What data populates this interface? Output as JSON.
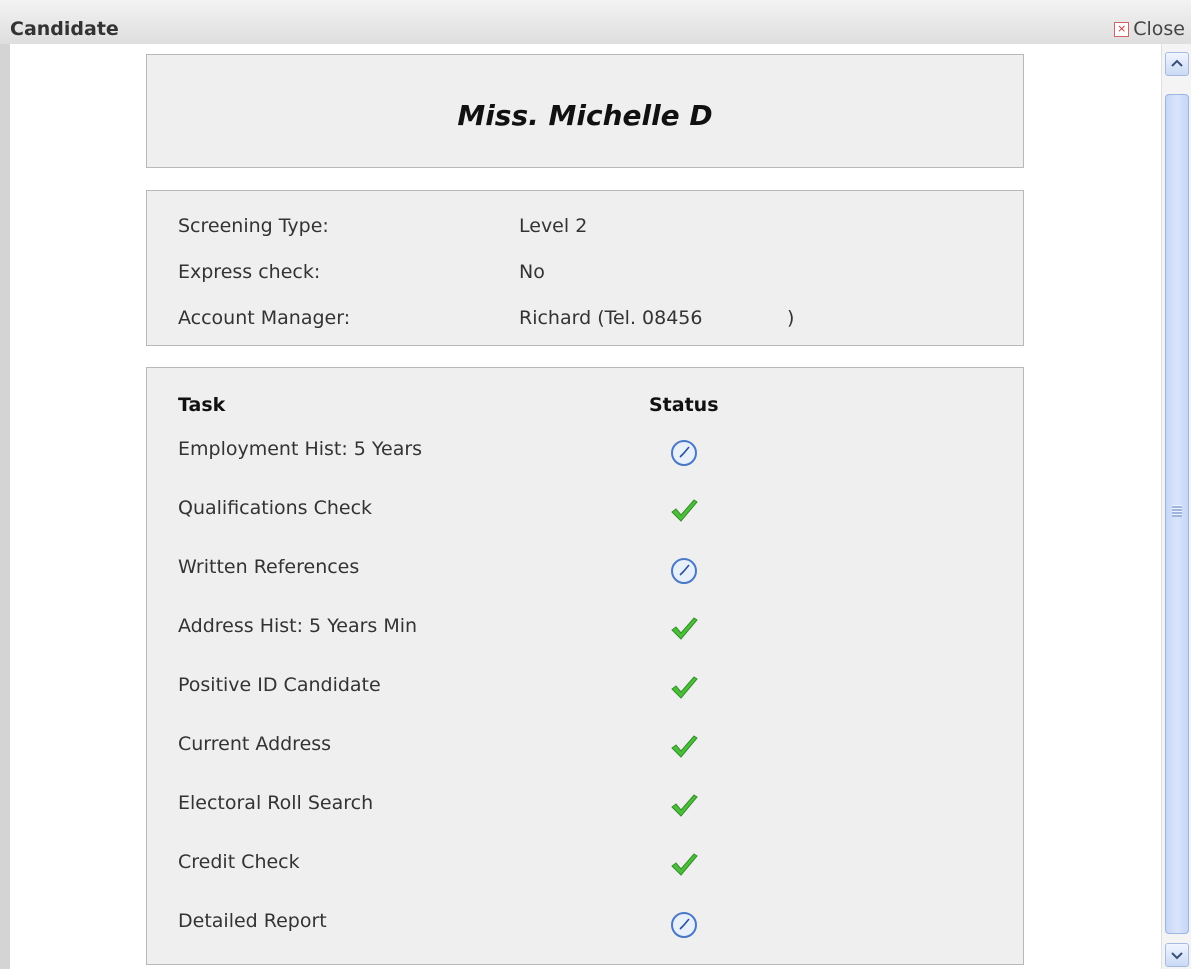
{
  "window": {
    "title": "Candidate",
    "close_label": "Close"
  },
  "candidate": {
    "name": "Miss. Michelle D"
  },
  "info": [
    {
      "label": "Screening Type:",
      "value": "Level 2"
    },
    {
      "label": "Express check:",
      "value": "No"
    },
    {
      "label": "Account Manager:",
      "value": "Richard (Tel. 08456              )"
    }
  ],
  "tasks": {
    "header_task": "Task",
    "header_status": "Status",
    "rows": [
      {
        "name": "Employment Hist: 5 Years",
        "status": "pending"
      },
      {
        "name": "Qualifications Check",
        "status": "complete"
      },
      {
        "name": "Written References",
        "status": "pending"
      },
      {
        "name": "Address Hist: 5 Years Min",
        "status": "complete"
      },
      {
        "name": "Positive ID Candidate",
        "status": "complete"
      },
      {
        "name": "Current Address",
        "status": "complete"
      },
      {
        "name": "Electoral Roll Search",
        "status": "complete"
      },
      {
        "name": "Credit Check",
        "status": "complete"
      },
      {
        "name": "Detailed Report",
        "status": "pending"
      }
    ]
  },
  "icons": {
    "pending": "clock-icon",
    "complete": "checkmark-icon"
  },
  "colors": {
    "pending": "#4a78c8",
    "complete": "#4cbf3a"
  }
}
